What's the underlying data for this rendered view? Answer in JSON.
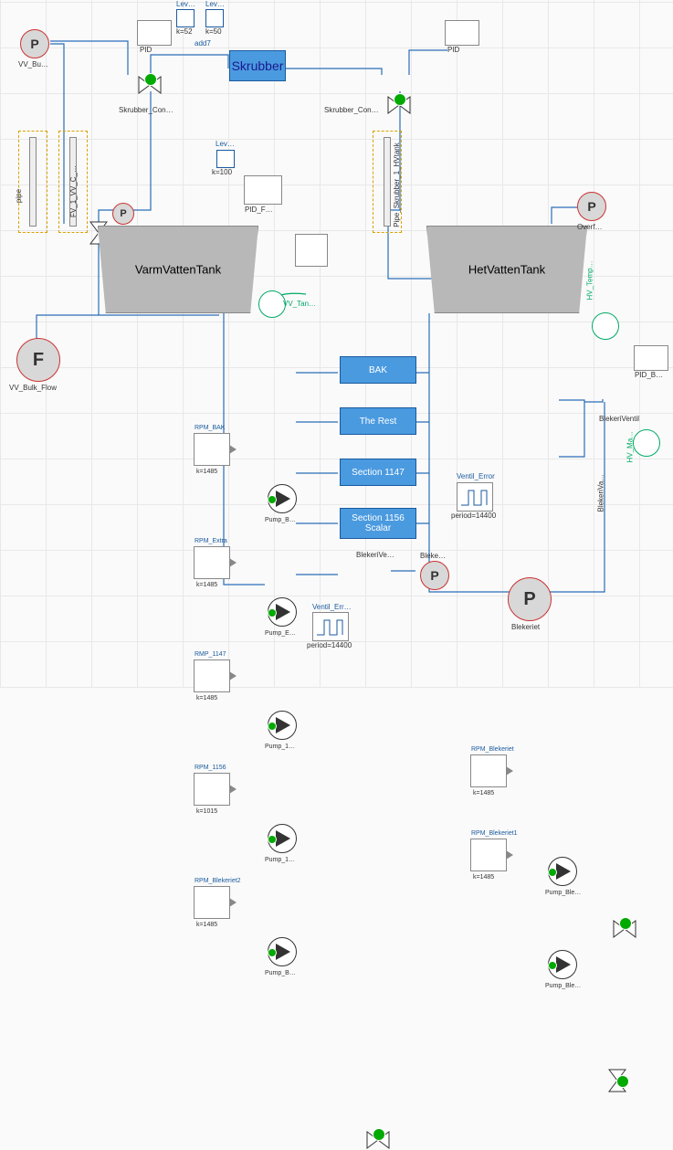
{
  "ports": {
    "p_vv_bulk": {
      "letter": "P",
      "label": "VV_Bu…"
    },
    "f_vv_bulk_flow": {
      "letter": "F",
      "label": "VV_Bulk_Flow"
    },
    "p_small_vv": {
      "letter": "P"
    },
    "p_overf": {
      "letter": "P",
      "label": "Overf…"
    },
    "p_blekeri_ve": {
      "letter": "P",
      "label": "Bleke…"
    },
    "p_blekeriet": {
      "letter": "P",
      "label": "Blekeriet"
    }
  },
  "tanks": {
    "varm": "VarmVattenTank",
    "het": "HetVattenTank"
  },
  "skrubber": {
    "label": "Skrubber"
  },
  "pipes": {
    "left": "pipe",
    "mid": "FV_1_VV_C_…",
    "right": "Pipe_Skrubber_1_HVtank"
  },
  "constants": {
    "rpm_bak": {
      "title": "RPM_BAK",
      "k": "k=1485"
    },
    "rpm_extra": {
      "title": "RPM_Extra",
      "k": "k=1485"
    },
    "rmp_1147": {
      "title": "RMP_1147",
      "k": "k=1485"
    },
    "rpm_1156": {
      "title": "RPM_1156",
      "k": "k=1015"
    },
    "rpm_blekeriet2": {
      "title": "RPM_Blekeriet2",
      "k": "k=1485"
    },
    "rpm_blekeriet": {
      "title": "RPM_Blekeriet",
      "k": "k=1485"
    },
    "rpm_blekeriet1": {
      "title": "RPM_Blekeriet1",
      "k": "k=1485"
    },
    "lev1": {
      "title": "Lev…",
      "k": "k=52"
    },
    "lev2": {
      "title": "Lev…",
      "k": "k=50"
    },
    "lev3": {
      "title": "Lev…",
      "k": "k=100"
    }
  },
  "pid": {
    "left": "PID",
    "mid": "PID_F…",
    "right": "PID",
    "btm_right": "PID_B…"
  },
  "gain_add": "add7",
  "bluebox": {
    "bak": "BAK",
    "rest": "The Rest",
    "s1147": "Section 1147",
    "s1156a": "Section 1156",
    "s1156b": "Scalar"
  },
  "pumps": {
    "b1": "Pump_B…",
    "e": "Pump_E…",
    "p1": "Pump_1…",
    "p2": "Pump_1…",
    "b2": "Pump_B…",
    "ble": "Pump_Ble…",
    "ble2": "Pump_Ble…"
  },
  "valves": {
    "sk_con_l": "Skrubber_Con…",
    "sk_con_r": "Skrubber_Con…",
    "blekeri_ve": "BlekeriVe…",
    "blekeri_ventil": "BlekeriVentil",
    "blekeri_va": "BlekeriVa…"
  },
  "sensors": {
    "vv_tan": "VV_Tan…",
    "hv_temp": "HV_Temp…",
    "hv_ma": "HV_Ma…"
  },
  "pulse": {
    "ventil_error": {
      "title": "Ventil_Error",
      "period": "period=14400"
    },
    "ventil_err": {
      "title": "Ventil_Err…",
      "period": "period=14400"
    }
  }
}
